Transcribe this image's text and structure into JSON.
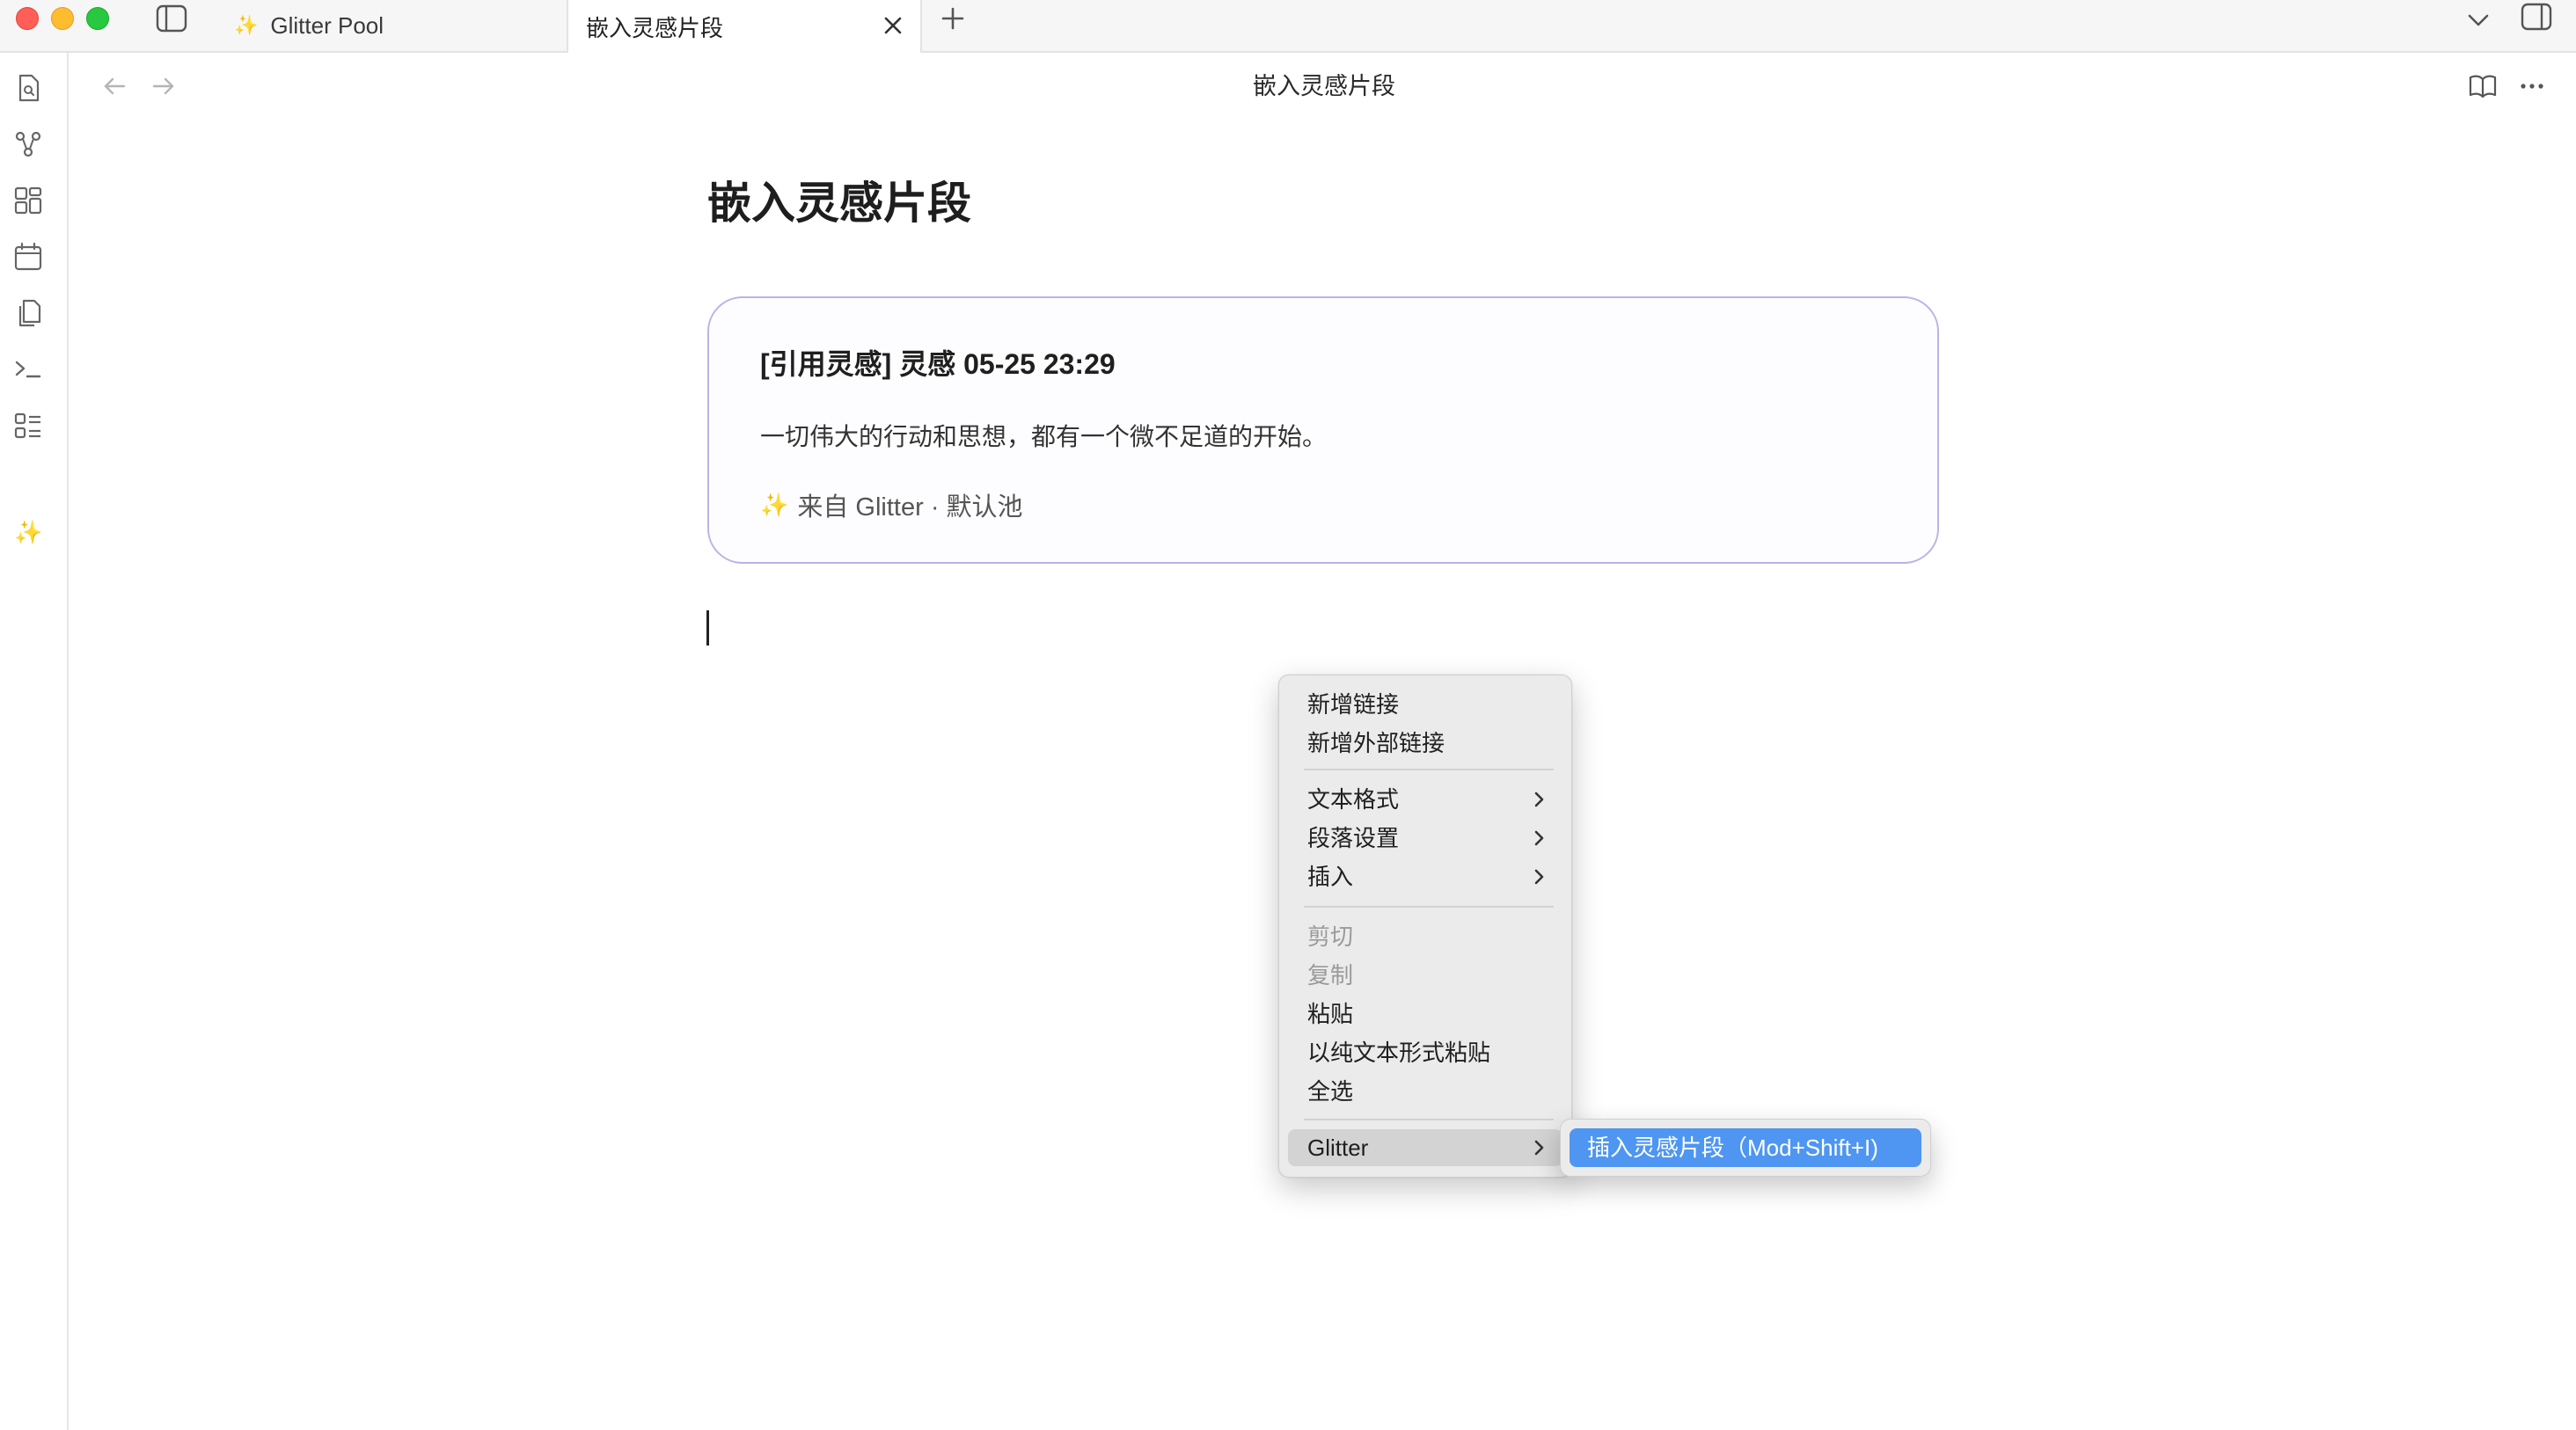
{
  "tabs": [
    {
      "label": "Glitter Pool",
      "icon": "sparkles-icon",
      "active": false
    },
    {
      "label": "嵌入灵感片段",
      "active": true
    }
  ],
  "view": {
    "title": "嵌入灵感片段"
  },
  "note": {
    "heading": "嵌入灵感片段",
    "callout": {
      "title": "[引用灵感] 灵感 05-25 23:29",
      "body": "一切伟大的行动和思想，都有一个微不足道的开始。",
      "footer": "来自 Glitter · 默认池",
      "footer_icon": "sparkles-icon",
      "border_color": "#b8b4e8"
    }
  },
  "ribbon": {
    "icons": [
      "search-file-icon",
      "graph-icon",
      "canvas-icon",
      "calendar-icon",
      "copy-files-icon",
      "terminal-icon",
      "outline-icon",
      "sparkles-icon"
    ]
  },
  "context_menu": {
    "items": [
      {
        "label": "新增链接",
        "enabled": true
      },
      {
        "label": "新增外部链接",
        "enabled": true
      },
      {
        "label": "文本格式",
        "enabled": true,
        "submenu": true
      },
      {
        "label": "段落设置",
        "enabled": true,
        "submenu": true
      },
      {
        "label": "插入",
        "enabled": true,
        "submenu": true
      },
      {
        "label": "剪切",
        "enabled": false
      },
      {
        "label": "复制",
        "enabled": false
      },
      {
        "label": "粘贴",
        "enabled": true
      },
      {
        "label": "以纯文本形式粘贴",
        "enabled": true
      },
      {
        "label": "全选",
        "enabled": true
      },
      {
        "label": "Glitter",
        "enabled": true,
        "submenu": true,
        "highlighted": true
      }
    ],
    "submenu": {
      "label": "插入灵感片段（Mod+Shift+I)",
      "highlight_color": "#4e96f1"
    }
  },
  "colors": {
    "accent": "#4e96f1",
    "sparkle": "#f0c419",
    "close": "#ff5f57",
    "minimize": "#febc2e",
    "maximize": "#28c840"
  }
}
